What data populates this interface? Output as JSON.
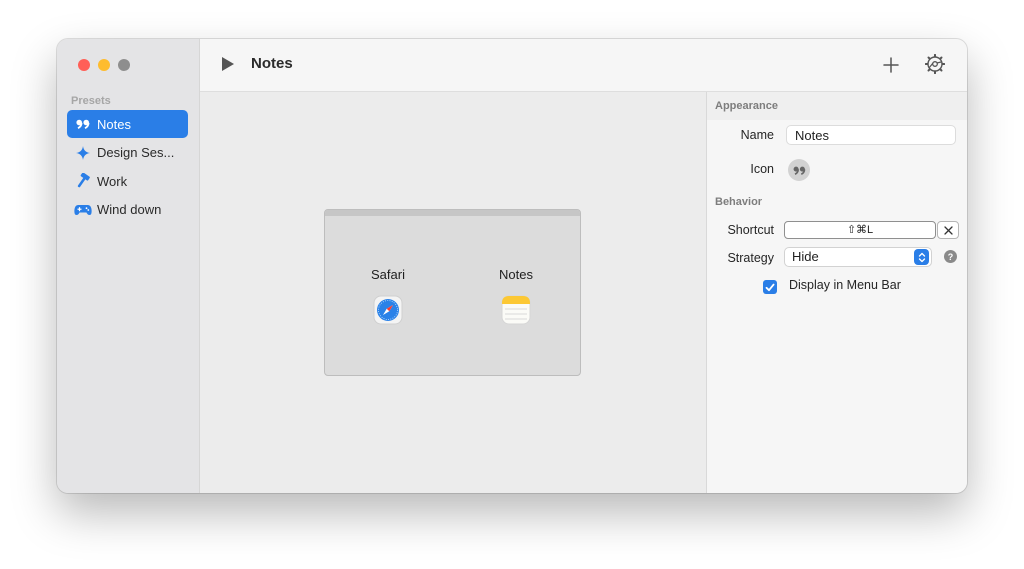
{
  "sidebar": {
    "section_label": "Presets",
    "items": [
      {
        "label": "Notes",
        "icon": "quote-icon",
        "active": true
      },
      {
        "label": "Design Ses...",
        "icon": "sparkle-icon",
        "active": false
      },
      {
        "label": "Work",
        "icon": "hammer-icon",
        "active": false
      },
      {
        "label": "Wind down",
        "icon": "gamecontroller-icon",
        "active": false
      }
    ]
  },
  "toolbar": {
    "title": "Notes",
    "play_icon": "play-icon",
    "add_icon": "plus-icon",
    "settings_icon": "gear-icon"
  },
  "canvas": {
    "apps": [
      {
        "name": "Safari",
        "icon": "safari-icon"
      },
      {
        "name": "Notes",
        "icon": "notes-app-icon"
      }
    ]
  },
  "inspector": {
    "appearance_label": "Appearance",
    "name_label": "Name",
    "name_value": "Notes",
    "icon_label": "Icon",
    "behavior_label": "Behavior",
    "shortcut_label": "Shortcut",
    "shortcut_value": "⇧⌘L",
    "strategy_label": "Strategy",
    "strategy_value": "Hide",
    "help_glyph": "?",
    "display_menu_bar_label": "Display in Menu Bar",
    "display_menu_bar_checked": true
  },
  "colors": {
    "accent": "#2a7ee7",
    "close": "#ff5f57",
    "minimize": "#febc2e",
    "zoom": "#8e8e8e"
  }
}
